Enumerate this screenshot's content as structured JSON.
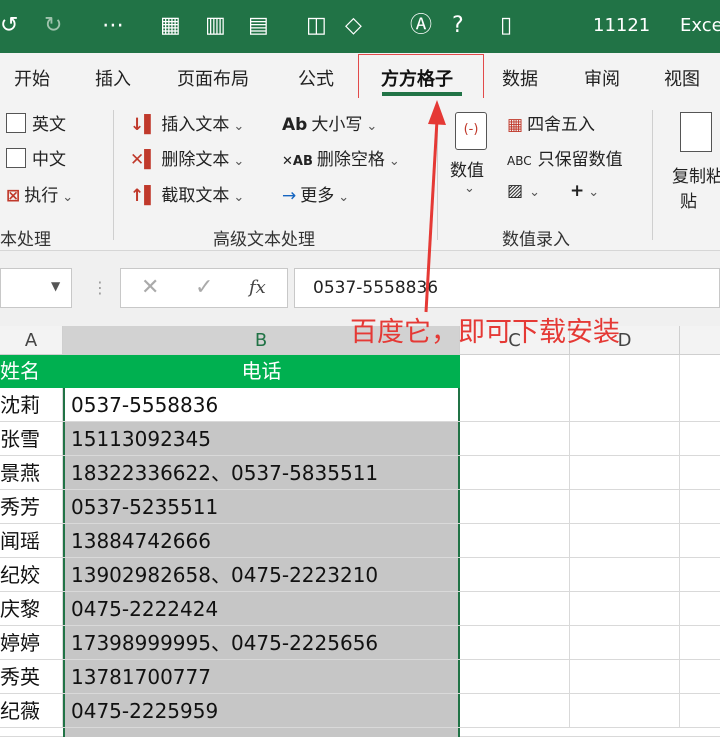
{
  "titlebar": {
    "filename": "11121",
    "app": "Exce"
  },
  "tabs": [
    "开始",
    "插入",
    "页面布局",
    "公式",
    "方方格子",
    "数据",
    "审阅",
    "视图"
  ],
  "active_tab": "方方格子",
  "ribbon": {
    "text_group": {
      "items": [
        "英文",
        "中文",
        "执行"
      ],
      "label": "本处理"
    },
    "advanced_text": {
      "items": [
        "插入文本",
        "删除文本",
        "截取文本",
        "大小写",
        "删除空格",
        "更多"
      ],
      "label": "高级文本处理"
    },
    "number_entry": {
      "value_button": "数值",
      "items": [
        "四舍五入",
        "只保留数值"
      ],
      "label": "数值录入"
    },
    "copy": {
      "line1": "复制粘",
      "line2": "贴"
    }
  },
  "formula_bar": {
    "fx": "fx",
    "value": "0537-5558836"
  },
  "columns": [
    "A",
    "B",
    "C",
    "D"
  ],
  "sheet": {
    "header": {
      "name": "姓名",
      "phone": "电话"
    },
    "rows": [
      {
        "name": "沈莉",
        "phone": "0537-5558836"
      },
      {
        "name": "张雪",
        "phone": "15113092345"
      },
      {
        "name": "景燕",
        "phone": "18322336622、0537-5835511"
      },
      {
        "name": "秀芳",
        "phone": "0537-5235511"
      },
      {
        "name": "闻瑶",
        "phone": "13884742666"
      },
      {
        "name": "纪姣",
        "phone": "13902982658、0475-2223210"
      },
      {
        "name": "庆黎",
        "phone": "0475-2222424"
      },
      {
        "name": "婷婷",
        "phone": "17398999995、0475-2225656"
      },
      {
        "name": "秀英",
        "phone": "13781700777"
      },
      {
        "name": "纪薇",
        "phone": "0475-2225959"
      }
    ]
  },
  "annotation": "百度它，即可下载安装",
  "colors": {
    "excel_green": "#217346",
    "header_green": "#00b050",
    "annotation_red": "#e53935"
  }
}
